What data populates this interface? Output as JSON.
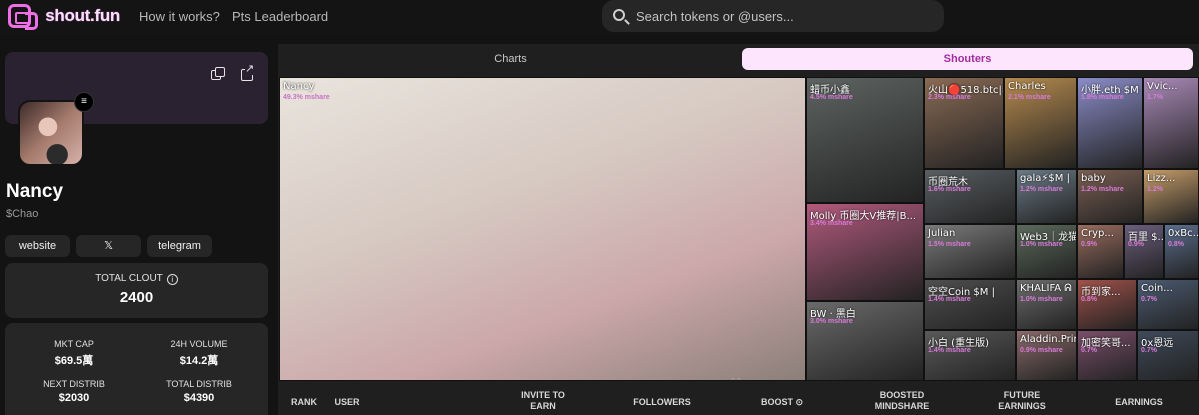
{
  "nav": {
    "logo_text": "shout.fun",
    "links": [
      "How it works?",
      "Pts Leaderboard"
    ],
    "search_placeholder": "Search tokens or @users..."
  },
  "profile": {
    "name": "Nancy",
    "ticker": "$Chao",
    "links": [
      "website",
      "𝕏",
      "telegram"
    ],
    "total_clout_label": "TOTAL CLOUT",
    "total_clout_value": "2400",
    "stats": [
      {
        "label": "MKT CAP",
        "value": "$69.5萬"
      },
      {
        "label": "24H VOLUME",
        "value": "$14.2萬"
      },
      {
        "label": "NEXT DISTRIB",
        "value": "$2030"
      },
      {
        "label": "TOTAL DISTRIB",
        "value": "$4390"
      }
    ]
  },
  "tabs": [
    "Charts",
    "Shouters"
  ],
  "active_tab": "Shouters",
  "shouters": [
    {
      "label": "Nancy",
      "share": "49.3% mshare"
    },
    {
      "label": "蜡币小鑫",
      "share": "4.5% mshare"
    },
    {
      "label": "Molly 币圈大V推荐|B...",
      "share": "3.4% mshare"
    },
    {
      "label": "BW · 黑白",
      "share": "3.0% mshare"
    },
    {
      "label": "火山🔴518.btc|B...",
      "share": "2.3% mshare"
    },
    {
      "label": "Charles",
      "share": "2.1% mshare"
    },
    {
      "label": "小胖.eth $M",
      "share": "1.8% mshare"
    },
    {
      "label": "Vvic...",
      "share": "1.7%"
    },
    {
      "label": "币圈荒木",
      "share": "1.6% mshare"
    },
    {
      "label": "gala⚡$M |",
      "share": "1.2% mshare"
    },
    {
      "label": "baby",
      "share": "1.2% mshare"
    },
    {
      "label": "Lizz...",
      "share": "1.2%"
    },
    {
      "label": "Julian",
      "share": "1.5% mshare"
    },
    {
      "label": "Web3｜龙猫",
      "share": "1.0% mshare"
    },
    {
      "label": "Cryp...",
      "share": "0.9%"
    },
    {
      "label": "百里 $...",
      "share": "0.9%"
    },
    {
      "label": "0xBc...",
      "share": "0.8%"
    },
    {
      "label": "空空Coin $M |",
      "share": "1.4% mshare"
    },
    {
      "label": "KHALIFA ᕱ",
      "share": "1.0% mshare"
    },
    {
      "label": "币到家...",
      "share": "0.8%"
    },
    {
      "label": "Coin...",
      "share": "0.7%"
    },
    {
      "label": "小白 (重生版)",
      "share": "1.4% mshare"
    },
    {
      "label": "Aladdin.Prince",
      "share": "0.9% mshare"
    },
    {
      "label": "加密笑哥...",
      "share": "0.7%"
    },
    {
      "label": "0x恩远",
      "share": "0.7%"
    }
  ],
  "table_headers": [
    "RANK",
    "USER",
    "INVITE TO EARN",
    "FOLLOWERS",
    "BOOST ⊙",
    "BOOSTED MINDSHARE",
    "FUTURE EARNINGS",
    "EARNINGS"
  ],
  "colors": {
    "accent": "#ee6fe6",
    "tab_active_bg": "#fde6fd",
    "share_text": "#d97bd9"
  }
}
